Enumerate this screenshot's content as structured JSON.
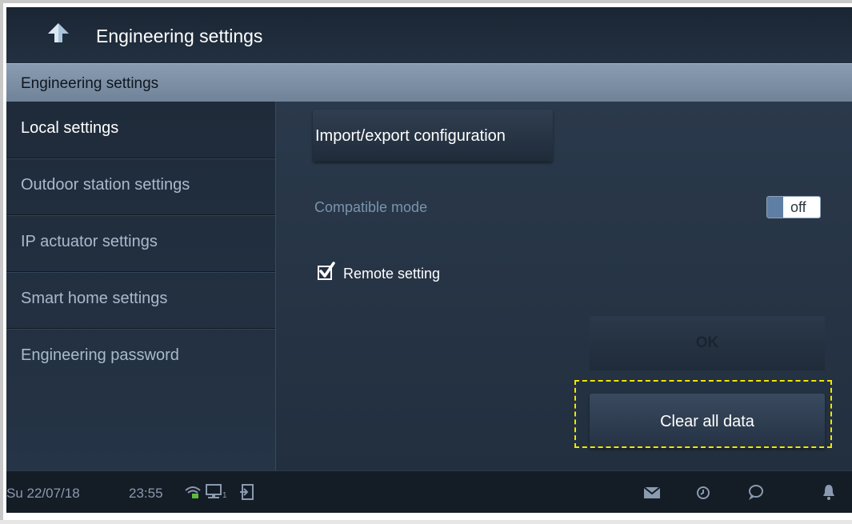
{
  "header": {
    "title": "Engineering settings"
  },
  "section": {
    "title": "Engineering settings"
  },
  "sidebar": {
    "items": [
      {
        "label": "Local settings",
        "active": true
      },
      {
        "label": "Outdoor station settings",
        "active": false
      },
      {
        "label": "IP actuator settings",
        "active": false
      },
      {
        "label": "Smart home settings",
        "active": false
      },
      {
        "label": "Engineering password",
        "active": false
      }
    ]
  },
  "main": {
    "import_export_label": "Import/export configuration",
    "compatible_mode": {
      "label": "Compatible mode",
      "state": "off"
    },
    "remote_setting": {
      "label": "Remote setting",
      "checked": true
    },
    "ok_label": "OK",
    "clear_label": "Clear all data"
  },
  "status": {
    "date": "Su 22/07/18",
    "time": "23:55",
    "network_index": "1"
  },
  "colors": {
    "accent": "#5e7fa3",
    "highlight": "#f2e600",
    "nav_active_text": "#ffffff",
    "nav_inactive_text": "#aab9cc"
  },
  "icons": [
    "back-arrow-icon",
    "wifi-icon",
    "network-icon",
    "exit-icon",
    "mail-icon",
    "history-icon",
    "chat-icon",
    "bell-icon"
  ]
}
